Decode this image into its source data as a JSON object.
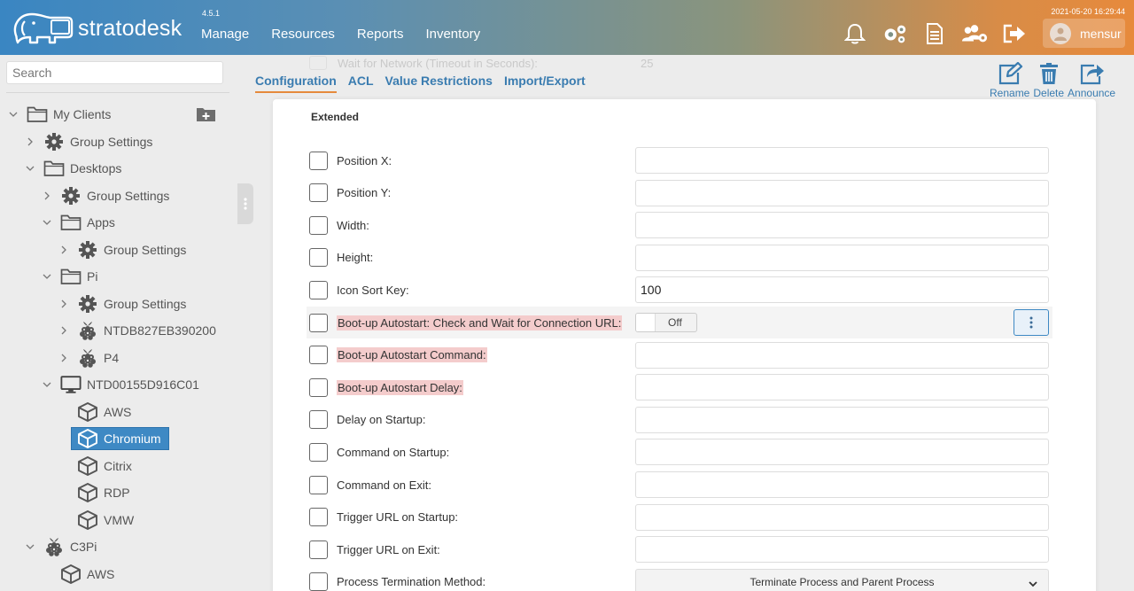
{
  "header": {
    "brand": "stratodesk",
    "version": "4.5.1",
    "nav": [
      "Manage",
      "Resources",
      "Reports",
      "Inventory"
    ],
    "datetime": "2021-05-20 16:29:44",
    "username": "mensur"
  },
  "sidebar": {
    "search_placeholder": "Search",
    "tree": [
      {
        "label": "My Clients",
        "icon": "folder-icon",
        "depth": 0,
        "expander": "chevron-down"
      },
      {
        "label": "Group Settings",
        "icon": "gear-icon",
        "depth": 1,
        "expander": "chevron-right"
      },
      {
        "label": "Desktops",
        "icon": "folder-icon",
        "depth": 1,
        "expander": "chevron-down"
      },
      {
        "label": "Group Settings",
        "icon": "gear-icon",
        "depth": 2,
        "expander": "chevron-right"
      },
      {
        "label": "Apps",
        "icon": "folder-icon",
        "depth": 2,
        "expander": "chevron-down"
      },
      {
        "label": "Group Settings",
        "icon": "gear-icon",
        "depth": 3,
        "expander": "chevron-right"
      },
      {
        "label": "Pi",
        "icon": "folder-icon",
        "depth": 2,
        "expander": "chevron-down"
      },
      {
        "label": "Group Settings",
        "icon": "gear-icon",
        "depth": 3,
        "expander": "chevron-right"
      },
      {
        "label": "NTDB827EB390200",
        "icon": "raspberry-icon",
        "depth": 3,
        "expander": "chevron-right"
      },
      {
        "label": "P4",
        "icon": "raspberry-icon",
        "depth": 3,
        "expander": "chevron-right"
      },
      {
        "label": "NTD00155D916C01",
        "icon": "monitor-icon",
        "depth": 2,
        "expander": "chevron-down"
      },
      {
        "label": "AWS",
        "icon": "cube-icon",
        "depth": 3,
        "expander": ""
      },
      {
        "label": "Chromium",
        "icon": "cube-icon",
        "depth": 3,
        "expander": "",
        "selected": true
      },
      {
        "label": "Citrix",
        "icon": "cube-icon",
        "depth": 3,
        "expander": ""
      },
      {
        "label": "RDP",
        "icon": "cube-icon",
        "depth": 3,
        "expander": ""
      },
      {
        "label": "VMW",
        "icon": "cube-icon",
        "depth": 3,
        "expander": ""
      },
      {
        "label": "C3Pi",
        "icon": "raspberry-icon",
        "depth": 1,
        "expander": "chevron-down"
      },
      {
        "label": "AWS",
        "icon": "cube-icon",
        "depth": 2,
        "expander": ""
      }
    ]
  },
  "main": {
    "faded_row": {
      "label": "Wait for Network (Timeout in Seconds):",
      "value": "25"
    },
    "tabs": [
      {
        "label": "Configuration",
        "active": true
      },
      {
        "label": "ACL"
      },
      {
        "label": "Value Restrictions"
      },
      {
        "label": "Import/Export"
      }
    ],
    "actions": [
      "Rename",
      "Delete",
      "Announce"
    ],
    "section_title": "Extended",
    "fields": [
      {
        "label": "Position X:",
        "type": "text",
        "value": ""
      },
      {
        "label": "Position Y:",
        "type": "text",
        "value": ""
      },
      {
        "label": "Width:",
        "type": "text",
        "value": ""
      },
      {
        "label": "Height:",
        "type": "text",
        "value": ""
      },
      {
        "label": "Icon Sort Key:",
        "type": "text",
        "value": "100"
      },
      {
        "label": "Boot-up Autostart: Check and Wait for Connection URL:",
        "type": "toggle",
        "value": "Off",
        "warn": true
      },
      {
        "label": "Boot-up Autostart Command:",
        "type": "text",
        "value": "",
        "warn": true
      },
      {
        "label": "Boot-up Autostart Delay:",
        "type": "text",
        "value": "",
        "warn": true
      },
      {
        "label": "Delay on Startup:",
        "type": "text",
        "value": ""
      },
      {
        "label": "Command on Startup:",
        "type": "text",
        "value": ""
      },
      {
        "label": "Command on Exit:",
        "type": "text",
        "value": ""
      },
      {
        "label": "Trigger URL on Startup:",
        "type": "text",
        "value": ""
      },
      {
        "label": "Trigger URL on Exit:",
        "type": "text",
        "value": ""
      },
      {
        "label": "Process Termination Method:",
        "type": "select",
        "value": "Terminate Process and Parent Process"
      }
    ]
  }
}
